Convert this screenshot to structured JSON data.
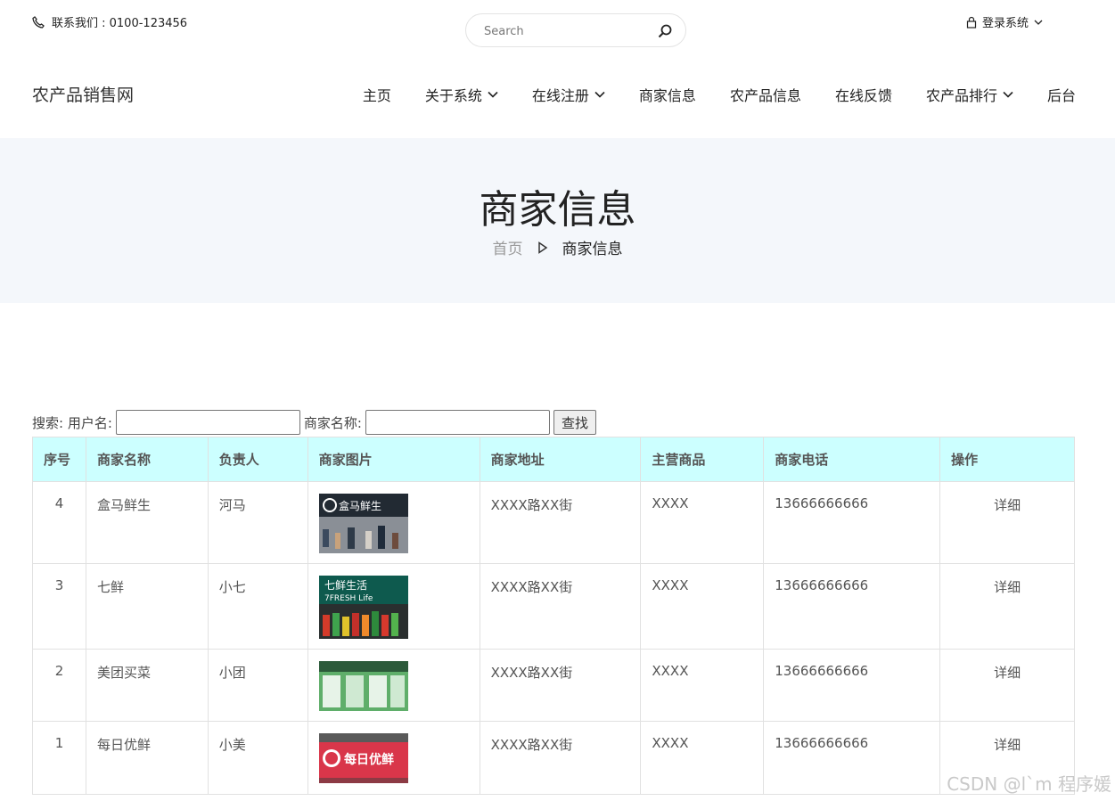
{
  "topbar": {
    "contact": "联系我们 : 0100-123456",
    "search_placeholder": "Search",
    "login": "登录系统"
  },
  "nav": {
    "brand": "农产品销售网",
    "items": [
      {
        "label": "主页",
        "dropdown": false
      },
      {
        "label": "关于系统",
        "dropdown": true
      },
      {
        "label": "在线注册",
        "dropdown": true
      },
      {
        "label": "商家信息",
        "dropdown": false
      },
      {
        "label": "农产品信息",
        "dropdown": false
      },
      {
        "label": "在线反馈",
        "dropdown": false
      },
      {
        "label": "农产品排行",
        "dropdown": true
      },
      {
        "label": "后台",
        "dropdown": false
      }
    ]
  },
  "banner": {
    "title": "商家信息",
    "crumb_home": "首页",
    "crumb_current": "商家信息"
  },
  "search_form": {
    "user_label": "搜索: 用户名:",
    "name_label": "商家名称:",
    "user_value": "",
    "name_value": "",
    "button": "查找"
  },
  "table": {
    "headers": [
      "序号",
      "商家名称",
      "负责人",
      "商家图片",
      "商家地址",
      "主营商品",
      "商家电话",
      "操作"
    ],
    "rows": [
      {
        "id": "4",
        "name": "盒马鲜生",
        "owner": "河马",
        "image": "storefront-hema",
        "address": "XXXX路XX街",
        "goods": "XXXX",
        "phone": "13666666666",
        "action": "详细"
      },
      {
        "id": "3",
        "name": "七鲜",
        "owner": "小七",
        "image": "storefront-7fresh",
        "address": "XXXX路XX街",
        "goods": "XXXX",
        "phone": "13666666666",
        "action": "详细"
      },
      {
        "id": "2",
        "name": "美团买菜",
        "owner": "小团",
        "image": "storefront-meituan",
        "address": "XXXX路XX街",
        "goods": "XXXX",
        "phone": "13666666666",
        "action": "详细"
      },
      {
        "id": "1",
        "name": "每日优鲜",
        "owner": "小美",
        "image": "storefront-missfresh",
        "address": "XXXX路XX街",
        "goods": "XXXX",
        "phone": "13666666666",
        "action": "详细"
      }
    ]
  },
  "images": {
    "hema_sign": "盒马鲜生",
    "fresh_sign": "七鲜生活",
    "fresh_sub": "7FRESH Life",
    "missfresh_sign": "每日优鲜"
  },
  "watermark": "CSDN @l`m 程序媛",
  "colors": {
    "header_bg": "#ccffff",
    "banner_bg": "#f4f7fb"
  }
}
